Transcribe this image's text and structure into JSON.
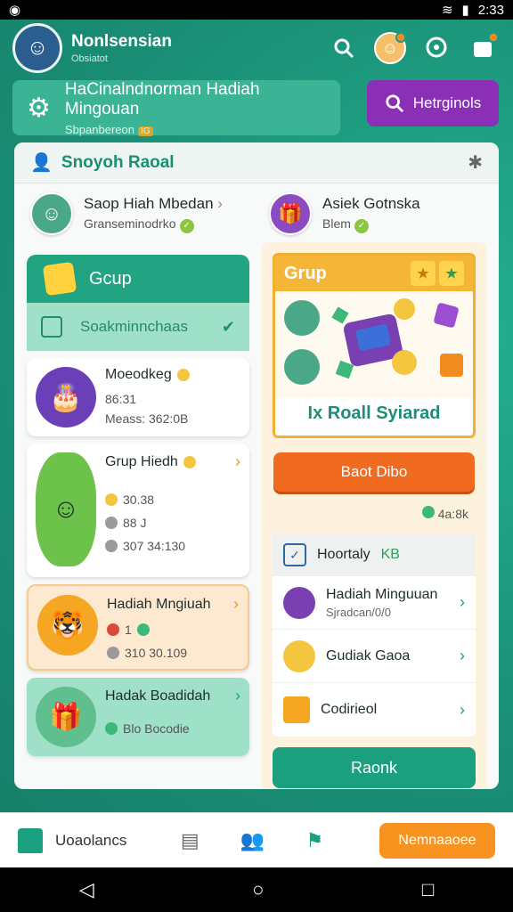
{
  "status": {
    "time": "2:33"
  },
  "header": {
    "title": "Nonlsensian",
    "subtitle": "Obsiatot",
    "icons": [
      "search-icon",
      "profile-icon",
      "chat-icon",
      "wallet-icon"
    ]
  },
  "banner": {
    "title": "HaCinalndnorman Hadiah Mingouan",
    "subtitle": "Sbpanbereon",
    "tag": "IG"
  },
  "search_button": {
    "label": "Hetrginols"
  },
  "card": {
    "title": "Snoyoh Raoal",
    "profile_left": {
      "name": "Saop Hiah Mbedan",
      "sub": "Granseminodrko"
    },
    "profile_right": {
      "name": "Asiek Gotnska",
      "sub": "Blem"
    },
    "left_group": {
      "title": "Gcup",
      "sub": "Soakminnchaas",
      "items": [
        {
          "title": "Moeodkeg",
          "meta1": "86:31",
          "meta2": "Meass: 362:0B"
        },
        {
          "title": "Grup Hiedh",
          "meta1": "30.38",
          "meta2": "88 J",
          "meta3": "307 34:130"
        },
        {
          "title": "Hadiah Mngiuah",
          "meta1": "1",
          "meta2": "310 30.109"
        },
        {
          "title": "Hadak Boadidah",
          "meta1": "Blo Bocodie"
        }
      ]
    },
    "right_group": {
      "title": "Grup",
      "caption": "Ix Roall Syiarad",
      "button": "Baot Dibo",
      "count": "4a:8k",
      "list_head": "Hoortaly",
      "list_head_tag": "KB",
      "list_items": [
        {
          "title": "Hadiah Minguuan",
          "sub": "Sjradcan/0/0",
          "icon_color": "#7a3fb0"
        },
        {
          "title": "Gudiak Gaoa",
          "sub": "",
          "icon_color": "#f4c53e"
        },
        {
          "title": "Codirieol",
          "sub": "",
          "icon_color": "#f5a623"
        }
      ],
      "bottom_button": "Raonk"
    }
  },
  "bottom_nav": {
    "home_label": "Uoaolancs",
    "pill": "Nemnaaoee"
  },
  "colors": {
    "accent": "#1aa07f",
    "orange": "#f06b20",
    "purple": "#8b2fb6"
  }
}
